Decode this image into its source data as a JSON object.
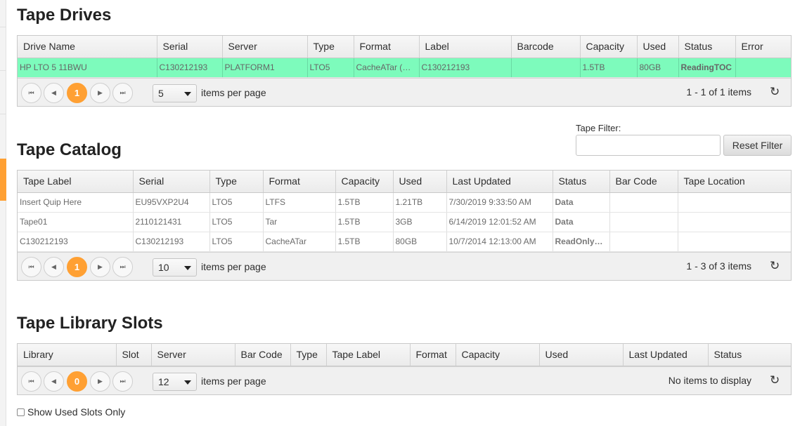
{
  "drives": {
    "title": "Tape Drives",
    "columns": [
      "Drive Name",
      "Serial",
      "Server",
      "Type",
      "Format",
      "Label",
      "Barcode",
      "Capacity",
      "Used",
      "Status",
      "Error"
    ],
    "rows": [
      [
        "HP LTO 5 11BWU",
        "C130212193",
        "PLATFORM1",
        "LTO5",
        "CacheATar (R…",
        "C130212193",
        "",
        "1.5TB",
        "80GB",
        "ReadingTOC",
        ""
      ]
    ],
    "pager": {
      "current_page": "1",
      "page_size": "5",
      "items_per_page_label": "items per page",
      "info": "1 - 1 of 1 items"
    }
  },
  "catalog": {
    "title": "Tape Catalog",
    "filter_label": "Tape Filter:",
    "filter_value": "",
    "reset_button": "Reset Filter",
    "columns": [
      "Tape Label",
      "Serial",
      "Type",
      "Format",
      "Capacity",
      "Used",
      "Last Updated",
      "Status",
      "Bar Code",
      "Tape Location"
    ],
    "rows": [
      [
        "Insert Quip Here",
        "EU95VXP2U4",
        "LTO5",
        "LTFS",
        "1.5TB",
        "1.21TB",
        "7/30/2019 9:33:50 AM",
        "Data",
        "",
        ""
      ],
      [
        "Tape01",
        "2110121431",
        "LTO5",
        "Tar",
        "1.5TB",
        "3GB",
        "6/14/2019 12:01:52 AM",
        "Data",
        "",
        ""
      ],
      [
        "C130212193",
        "C130212193",
        "LTO5",
        "CacheATar",
        "1.5TB",
        "80GB",
        "10/7/2014 12:13:00 AM",
        "ReadOnly…",
        "",
        ""
      ]
    ],
    "pager": {
      "current_page": "1",
      "page_size": "10",
      "items_per_page_label": "items per page",
      "info": "1 - 3 of 3 items"
    }
  },
  "slots": {
    "title": "Tape Library Slots",
    "columns": [
      "Library",
      "Slot",
      "Server",
      "Bar Code",
      "Type",
      "Tape Label",
      "Format",
      "Capacity",
      "Used",
      "Last Updated",
      "Status"
    ],
    "pager": {
      "current_page": "0",
      "page_size": "12",
      "items_per_page_label": "items per page",
      "info": "No items to display"
    },
    "show_used_label": "Show Used Slots Only"
  },
  "icons": {
    "first": "first-page-icon",
    "prev": "prev-page-icon",
    "next": "next-page-icon",
    "last": "last-page-icon",
    "refresh": "refresh-icon"
  },
  "colors": {
    "accent": "#ffa033",
    "selected_row": "#7dfbbc"
  }
}
